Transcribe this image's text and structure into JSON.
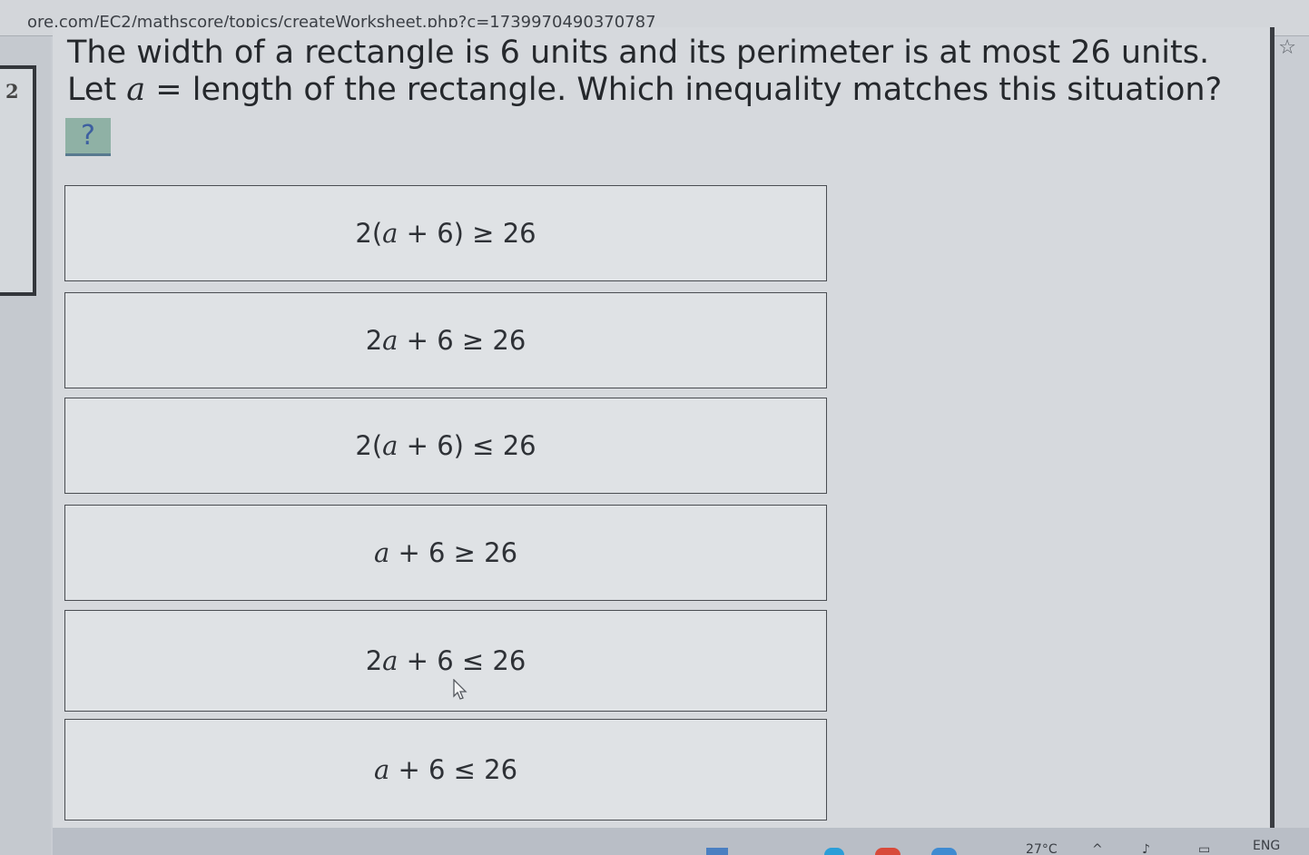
{
  "browser": {
    "url": "ore.com/EC2/mathscore/topics/createWorksheet.php?c=1739970490370787",
    "bookmark_icon": "star-icon"
  },
  "question": {
    "number": "2",
    "line1": "The width of a rectangle is 6 units and its perimeter is at most 26 units.",
    "line2_prefix": "Let ",
    "line2_var": "a",
    "line2_rest": " = length of the rectangle. Which inequality matches this situation?",
    "help_label": "?"
  },
  "options": [
    {
      "pre": "2(",
      "var": "a",
      "post": " + 6) ≥ 26"
    },
    {
      "pre": "2",
      "var": "a",
      "post": " + 6 ≥ 26"
    },
    {
      "pre": "2(",
      "var": "a",
      "post": " + 6) ≤ 26"
    },
    {
      "pre": "",
      "var": "a",
      "post": " + 6 ≥ 26"
    },
    {
      "pre": "2",
      "var": "a",
      "post": " + 6 ≤ 26"
    },
    {
      "pre": "",
      "var": "a",
      "post": " + 6 ≤ 26"
    }
  ],
  "taskbar": {
    "temperature": "27°C",
    "language": "ENG"
  },
  "colors": {
    "accent": "#8fb1a5",
    "border": "#4a4d52"
  }
}
